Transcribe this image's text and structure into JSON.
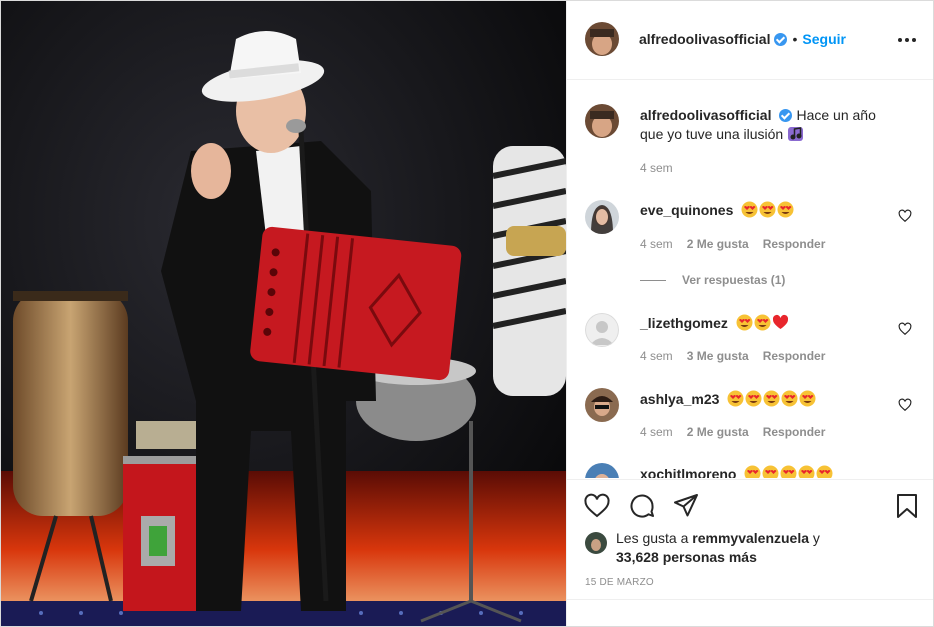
{
  "post": {
    "author": "alfredoolivasofficial",
    "follow_label": "Seguir",
    "separator": "•"
  },
  "caption": {
    "username": "alfredoolivasofficial",
    "text": "Hace un año que yo tuve una ilusión",
    "time": "4 sem"
  },
  "comments": [
    {
      "username": "eve_quinones",
      "time": "4 sem",
      "likes": "2 Me gusta",
      "reply_label": "Responder",
      "view_replies": "Ver respuestas (1)"
    },
    {
      "username": "_lizethgomez",
      "time": "4 sem",
      "likes": "3 Me gusta",
      "reply_label": "Responder"
    },
    {
      "username": "ashlya_m23",
      "time": "4 sem",
      "likes": "2 Me gusta",
      "reply_label": "Responder"
    },
    {
      "username": "xochitlmoreno"
    }
  ],
  "likes": {
    "prefix": "Les gusta a",
    "user": "remmyvalenzuela",
    "conj": "y",
    "others": "33,628 personas más"
  },
  "date": "15 DE MARZO",
  "icons": {
    "more": "more-options-icon",
    "like": "heart-icon",
    "comment": "comment-icon",
    "share": "paper-plane-icon",
    "save": "bookmark-icon",
    "verified": "verified-badge-icon"
  },
  "colors": {
    "link": "#0095f6",
    "verified": "#3897f0",
    "muted": "#8e8e8e",
    "text": "#262626"
  }
}
